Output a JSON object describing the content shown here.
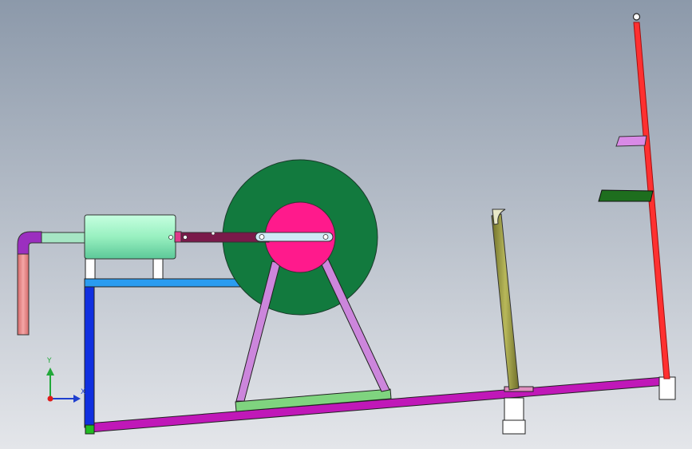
{
  "viewport": {
    "background_top": "#8c99aa",
    "background_bottom": "#e4e6ea"
  },
  "triad": {
    "y_label": "Y",
    "x_label": "X",
    "colors": {
      "x": "#1f3fcf",
      "y": "#22a83a",
      "z": "#e01b1b"
    }
  },
  "colors": {
    "inlet_pipe": "#f4a6a6",
    "elbow": "#9b2fbf",
    "pipe_connector": "#a6e6c4",
    "cylinder": "#98f0c0",
    "piston_rod": "#7a1a4a",
    "connecting_link": "#cfe8f6",
    "flywheel": "#127a3e",
    "hub": "#ff1a8c",
    "a_frame": "#cc86dc",
    "base_plate": "#7fd47f",
    "top_beam": "#2a9cf0",
    "vertical_post": "#1030e0",
    "ground_beam": "#c018b8",
    "corner_block": "#22bb22",
    "guide_tube": "#b8b85a",
    "mast": "#ff3030",
    "upper_tab": "#d98ae6",
    "lower_tab": "#1e6e1e",
    "pedestal": "#ffffff"
  }
}
